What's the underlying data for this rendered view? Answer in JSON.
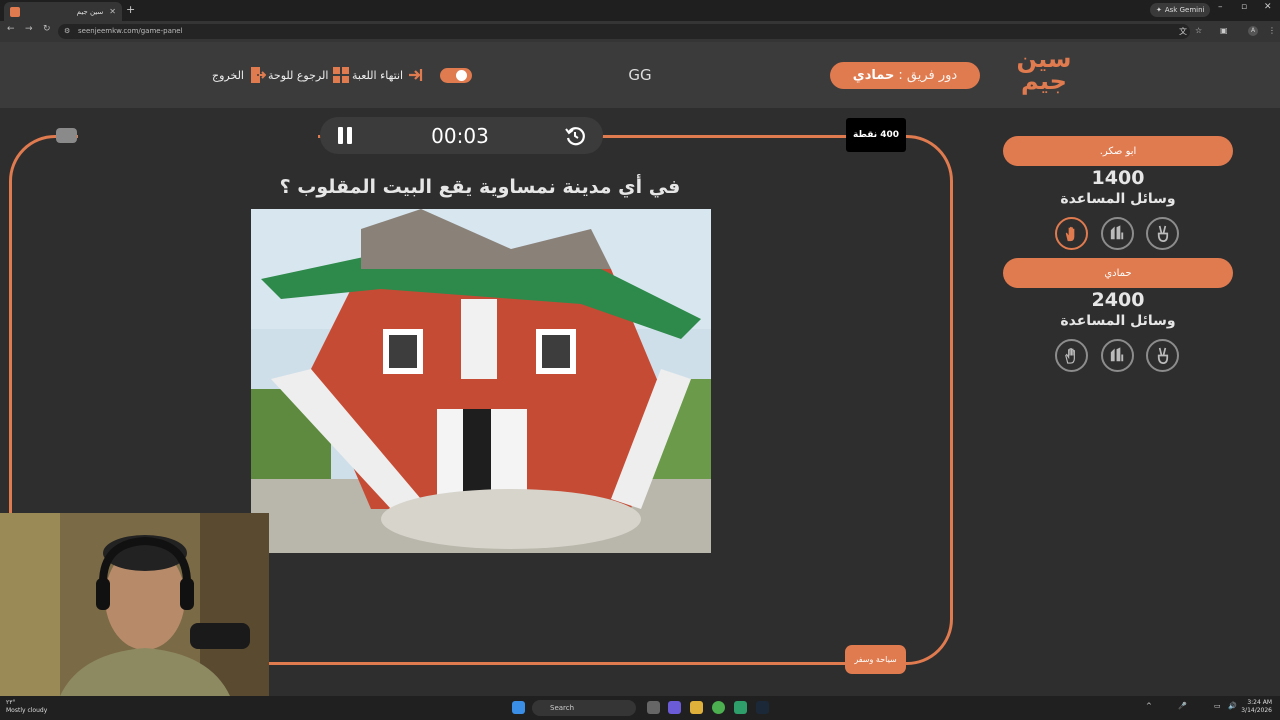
{
  "browser": {
    "tab_title": "سين جيم",
    "url": "seenjeemkw.com/game-panel",
    "ask_gemini": "Ask Gemini",
    "profile_initial": "A"
  },
  "header": {
    "logo_text": "سين جيم",
    "turn_label": "دور فريق :",
    "turn_team": "حمادي",
    "gg": "GG",
    "end_game": "انتهاء اللعبة",
    "back_to_board": "الرجوع للوحة",
    "exit": "الخروج"
  },
  "timer": {
    "time": "00:03"
  },
  "board": {
    "points": "400 نقطة",
    "question": "في أي مدينة نمساوية يقع البيت المقلوب ؟",
    "category": "سياحة وسفر"
  },
  "teams": [
    {
      "name": "ابو صكر.",
      "score": "1400",
      "aids_label": "وسائل المساعدة"
    },
    {
      "name": "حمادي",
      "score": "2400",
      "aids_label": "وسائل المساعدة"
    }
  ],
  "taskbar": {
    "weather_temp": "٢٣°",
    "weather_desc": "Mostly cloudy",
    "search": "Search",
    "time": "3:24 AM",
    "date": "3/14/2026"
  },
  "colors": {
    "accent": "#e07a4f",
    "background": "#2e2e2e",
    "header": "#3b3b3b"
  }
}
